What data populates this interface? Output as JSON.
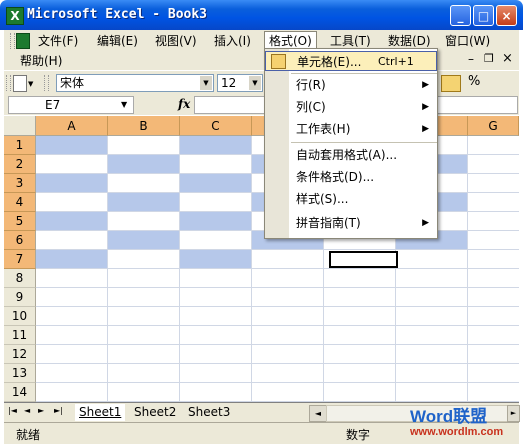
{
  "window": {
    "title": "Microsoft Excel - Book3",
    "app_icon_glyph": "X",
    "controls": {
      "minimize": "_",
      "maximize": "□",
      "close": "×"
    }
  },
  "menubar": {
    "items": [
      "文件(F)",
      "编辑(E)",
      "视图(V)",
      "插入(I)",
      "格式(O)",
      "工具(T)",
      "数据(D)",
      "窗口(W)"
    ],
    "second_row_item": "帮助(H)",
    "open_menu": "格式(O)",
    "doc_controls": {
      "minimize": "–",
      "restore": "❐",
      "close": "×"
    }
  },
  "toolbar": {
    "font_name": "宋体",
    "font_size": "12",
    "percent_icon": "%"
  },
  "formula_bar": {
    "name_box": "E7",
    "fx_label": "fx",
    "value": ""
  },
  "grid": {
    "columns": [
      "A",
      "B",
      "C",
      "D",
      "E",
      "F",
      "G"
    ],
    "rows": [
      "1",
      "2",
      "3",
      "4",
      "5",
      "6",
      "7",
      "8",
      "9",
      "10",
      "11",
      "12",
      "13",
      "14"
    ]
  },
  "sheet_tabs": {
    "nav": [
      "|◄",
      "◄",
      "►",
      "►|"
    ],
    "tabs": [
      "Sheet1",
      "Sheet2",
      "Sheet3"
    ],
    "active": "Sheet1"
  },
  "status_bar": {
    "left": "就绪",
    "mode": "数字"
  },
  "format_menu": {
    "items": [
      {
        "label": "单元格(E)...",
        "shortcut": "Ctrl+1",
        "selected": true,
        "submenu": false
      },
      {
        "label": "行(R)",
        "shortcut": "",
        "selected": false,
        "submenu": true
      },
      {
        "label": "列(C)",
        "shortcut": "",
        "selected": false,
        "submenu": true
      },
      {
        "label": "工作表(H)",
        "shortcut": "",
        "selected": false,
        "submenu": true
      },
      {
        "label": "自动套用格式(A)...",
        "shortcut": "",
        "selected": false,
        "submenu": false
      },
      {
        "label": "条件格式(D)...",
        "shortcut": "",
        "selected": false,
        "submenu": false
      },
      {
        "label": "样式(S)...",
        "shortcut": "",
        "selected": false,
        "submenu": false
      },
      {
        "label": "拼音指南(T)",
        "shortcut": "",
        "selected": false,
        "submenu": true
      }
    ]
  },
  "watermark": {
    "brand": "Word联盟",
    "url": "www.wordlm.com"
  },
  "colors": {
    "header_highlight": "#f3b877",
    "cell_highlight": "#b6c8ea",
    "chrome": "#ece9d8",
    "titlebar": "#0054e3"
  }
}
